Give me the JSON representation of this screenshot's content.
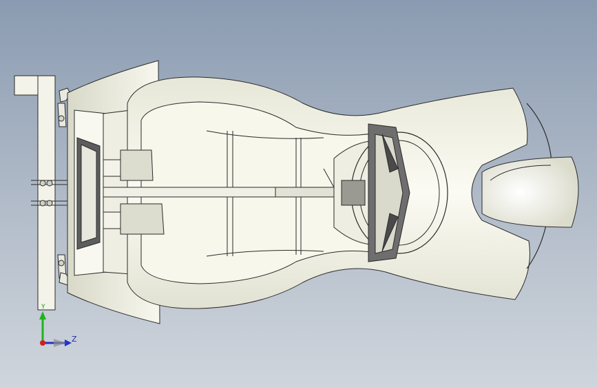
{
  "viewport": {
    "background_top": "#8a9bb1",
    "background_bottom": "#cfd5dc",
    "model_fill": "#f5f5ea",
    "model_shade": "#e6e6d8",
    "edge_color": "#2a2a2a"
  },
  "triad": {
    "y_label": "Y",
    "z_label": "Z",
    "y_color": "#1fb31f",
    "z_color": "#2233c8",
    "x_color": "#d11f1f"
  }
}
